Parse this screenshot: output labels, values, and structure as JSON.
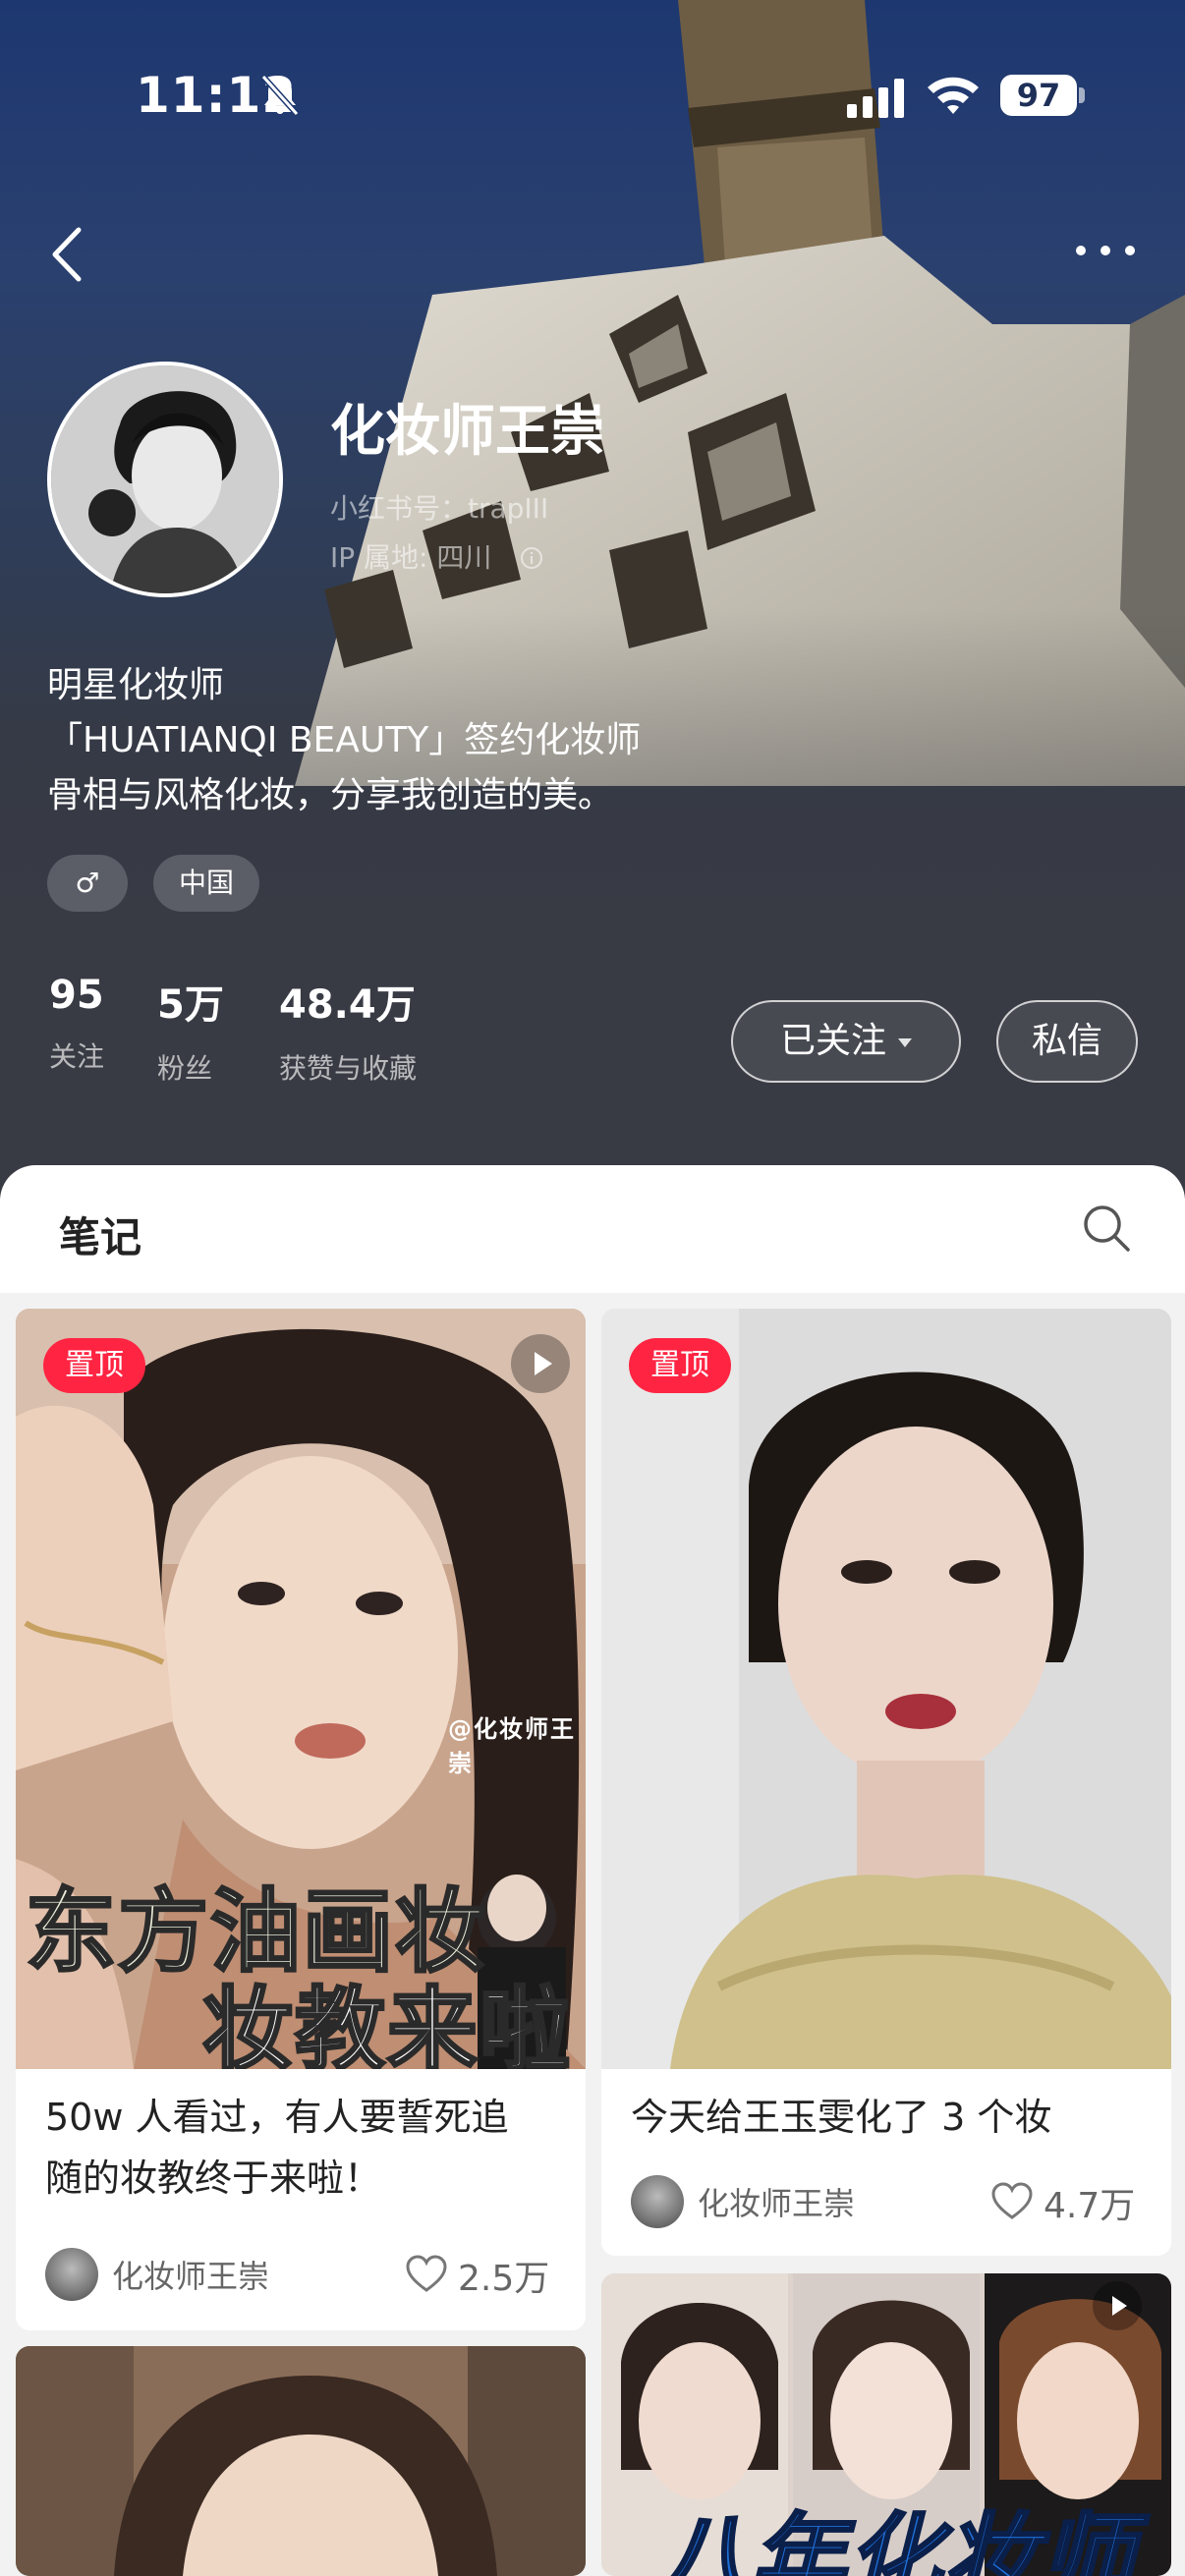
{
  "status": {
    "time": "11:12",
    "battery": "97",
    "icons": [
      "bell-muted-icon",
      "signal-icon",
      "wifi-icon",
      "battery-icon"
    ]
  },
  "nav": {
    "back_icon": "chevron-left-icon",
    "more_icon": "more-dots-icon"
  },
  "profile": {
    "nickname": "化妆师王崇",
    "redbook_id": "小红书号：trapIII",
    "ip_location": "IP 属地: 四川",
    "bio": [
      "明星化妆师",
      "「HUATIANQI BEAUTY」签约化妆师",
      "骨相与风格化妆，分享我创造的美。"
    ],
    "tags": {
      "gender": "♂",
      "region": "中国"
    },
    "stats": [
      {
        "value": "95",
        "label": "关注"
      },
      {
        "value": "5万",
        "label": "粉丝"
      },
      {
        "value": "48.4万",
        "label": "获赞与收藏"
      }
    ],
    "buttons": {
      "follow": "已关注",
      "message": "私信"
    }
  },
  "notes_tab": {
    "title": "笔记"
  },
  "feed": {
    "cards": [
      {
        "pinned": "置顶",
        "has_video": true,
        "overlay_handle": "@化妆师王崇",
        "overlay_line1": "东方油画妆",
        "overlay_line2": "妆教来啦",
        "title_line1": "50w 人看过，有人要誓死追",
        "title_line2": "随的妆教终于来啦！",
        "author": "化妆师王崇",
        "likes": "2.5万"
      },
      {
        "pinned": "置顶",
        "has_video": false,
        "title_line1": "今天给王玉雯化了 3 个妆",
        "author": "化妆师王崇",
        "likes": "4.7万"
      },
      {
        "has_video": true,
        "overlay_line1": "八年化妆师"
      },
      {
        "has_video": false
      }
    ]
  },
  "colors": {
    "accent": "#ff2442",
    "hero_top": "#1d3770",
    "hero_bottom": "#393b44"
  }
}
